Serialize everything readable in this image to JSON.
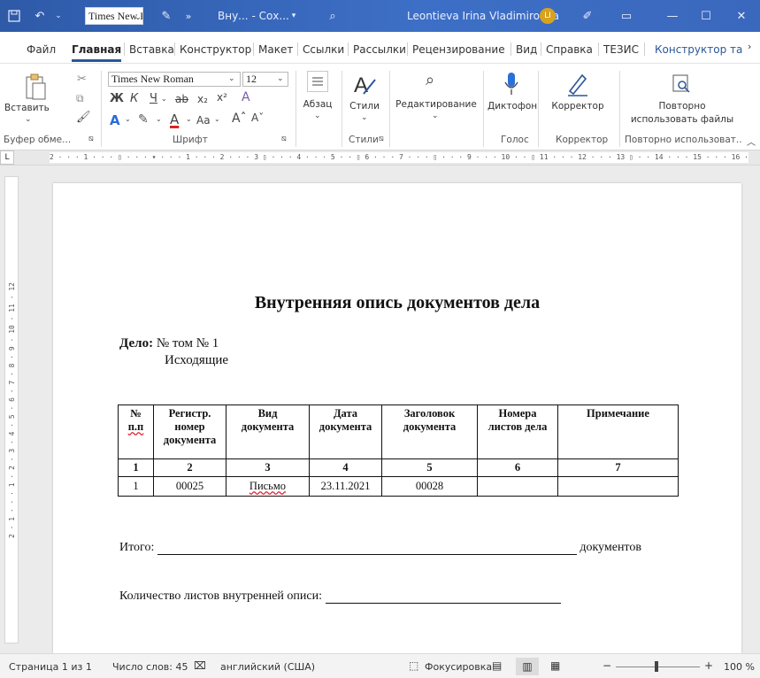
{
  "titlebar": {
    "font_box": "Times New R",
    "doc_name": "Вну... - Сох...",
    "user_name": "Leontieva Irina Vladimirovna",
    "user_initials": "LI"
  },
  "tabs": [
    "Файл",
    "Главная",
    "Вставка",
    "Конструктор",
    "Макет",
    "Ссылки",
    "Рассылки",
    "Рецензирование",
    "Вид",
    "Справка",
    "ТЕЗИС",
    "Конструктор табл"
  ],
  "ribbon": {
    "paste_label": "Вставить",
    "clipboard_group": "Буфер обме...",
    "font_name": "Times New Roman",
    "font_size": "12",
    "font_group": "Шрифт",
    "bold": "Ж",
    "italic": "К",
    "underline": "Ч",
    "strike": "ab",
    "subscript": "x₂",
    "superscript": "x²",
    "case": "Aa",
    "paragraph_label": "Абзац",
    "styles_label": "Стили",
    "styles_group": "Стили",
    "editing_label": "Редактирование",
    "dictation_label": "Диктофон",
    "voice_group": "Голос",
    "editor_label": "Корректор",
    "editor_group": "Корректор",
    "reuse_label_1": "Повторно",
    "reuse_label_2": "использовать файлы",
    "reuse_group": "Повторно использоват..."
  },
  "ruler": {
    "corner": "L",
    "marks": "2 · · · 1 · · · ▯ · · · ▾ · · · 1 · · · 2 · · · 3 ▯ · · · 4 · · · 5 · · ▯ 6 · · · 7 · · · ▯ · · · 9 · · · 10 · · ▯ 11 · · · 12 · · · 13 ▯ · · 14 · · · 15 · · · 16 · · · ▯ 17 · · · 18 · · ·",
    "vmarks": "2 · 1 · · · 1 · 2 · 3 · 4 · 5 · 6 · 7 · 8 · 9 · 10 · 11 · 12"
  },
  "document": {
    "title": "Внутренняя опись документов дела",
    "delo_label": "Дело:",
    "delo_value": "№  том № 1",
    "delo_sub": "Исходящие",
    "table_headers": [
      [
        "№",
        "п.п"
      ],
      [
        "Регистр.",
        "номер",
        "документа"
      ],
      [
        "Вид",
        "документа"
      ],
      [
        "Дата",
        "документа"
      ],
      [
        "Заголовок",
        "документа"
      ],
      [
        "Номера",
        "листов дела"
      ],
      [
        "Примечание"
      ]
    ],
    "column_numbers": [
      "1",
      "2",
      "3",
      "4",
      "5",
      "6",
      "7"
    ],
    "rows": [
      [
        "1",
        "00025",
        "Письмо",
        "23.11.2021",
        "00028",
        "",
        ""
      ]
    ],
    "itogo_label": "Итого:",
    "itogo_suffix": "документов",
    "kolvo_label": "Количество листов внутренней описи:"
  },
  "status": {
    "page": "Страница 1 из 1",
    "words": "Число слов: 45",
    "language": "английский (США)",
    "focus": "Фокусировка",
    "zoom": "100 %",
    "zoom_minus": "−",
    "zoom_plus": "+"
  },
  "colors": {
    "titlebar": "#2e5aa8",
    "accent": "#2b579a"
  }
}
